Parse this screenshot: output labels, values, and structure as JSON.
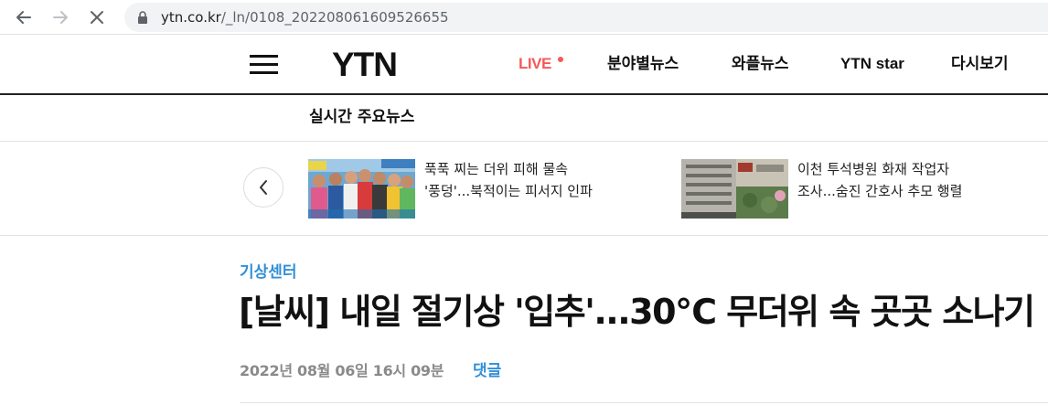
{
  "browser": {
    "url_domain": "ytn.co.kr",
    "url_path": "/_ln/0108_202208061609526655",
    "back_icon": "arrow-left-icon",
    "forward_icon": "arrow-right-icon",
    "stop_icon": "close-icon",
    "lock_icon": "lock-icon"
  },
  "header": {
    "logo": "YTN",
    "menu_icon": "hamburger-menu-icon",
    "nav": {
      "live": "LIVE",
      "section_news": "분야별뉴스",
      "wapeul_news": "와플뉴스",
      "ytn_star": "YTN star",
      "replay": "다시보기"
    },
    "live_color": "#f25a5a"
  },
  "realtime": {
    "title": "실시간 주요뉴스",
    "prev_icon": "chevron-left-icon",
    "items": [
      {
        "line1": "푹푹 찌는 더위 피해 물속",
        "line2": "'풍덩'...북적이는 피서지 인파"
      },
      {
        "line1": "이천 투석병원 화재 작업자",
        "line2": "조사...숨진 간호사 추모 행렬"
      }
    ]
  },
  "article": {
    "category": "기상센터",
    "headline": "[날씨] 내일 절기상 '입추'...30℃ 무더위 속 곳곳 소나기",
    "date": "2022년 08월 06일 16시 09분",
    "comment_label": "댓글",
    "accent_color": "#2f8fd8"
  }
}
